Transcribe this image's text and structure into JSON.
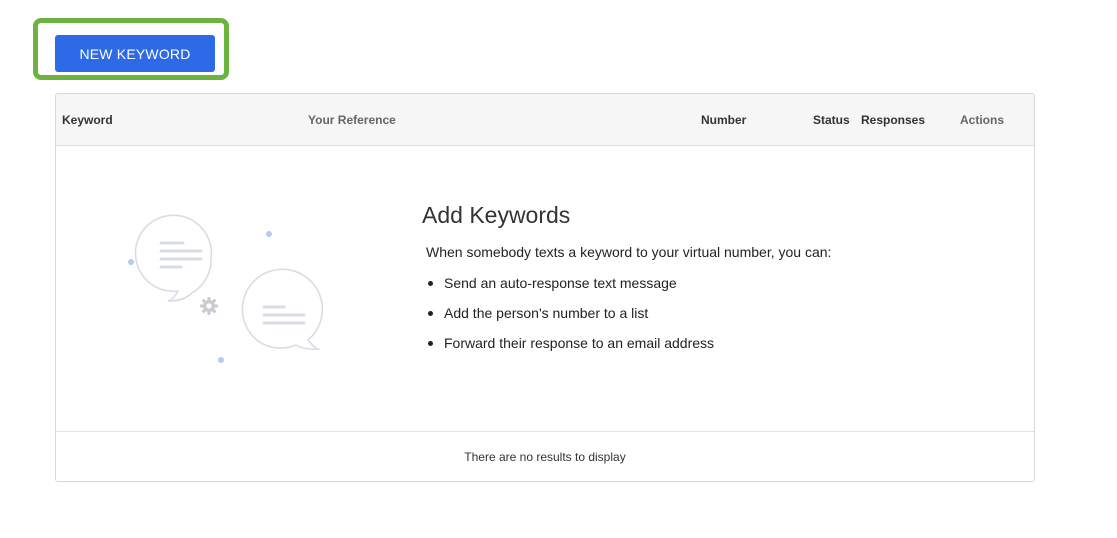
{
  "toolbar": {
    "new_keyword_label": "NEW KEYWORD"
  },
  "table": {
    "columns": [
      "Keyword",
      "Your Reference",
      "Number",
      "Status",
      "Responses",
      "Actions"
    ],
    "rows": []
  },
  "empty_state": {
    "title": "Add Keywords",
    "intro": "When somebody texts a keyword to your virtual number, you can:",
    "bullets": [
      "Send an auto-response text message",
      "Add the person's number to a list",
      "Forward their response to an email address"
    ],
    "illustration_icons": [
      "chat-bubble-icon",
      "chat-bubble-icon",
      "gear-icon"
    ]
  },
  "footer": {
    "no_results": "There are no results to display"
  },
  "colors": {
    "primary_button": "#2d6ae8",
    "highlight_border": "#6cb33f",
    "header_bg": "#f6f6f6",
    "illustration_line": "#d9dce3",
    "illustration_dot": "#b9c8ee"
  }
}
